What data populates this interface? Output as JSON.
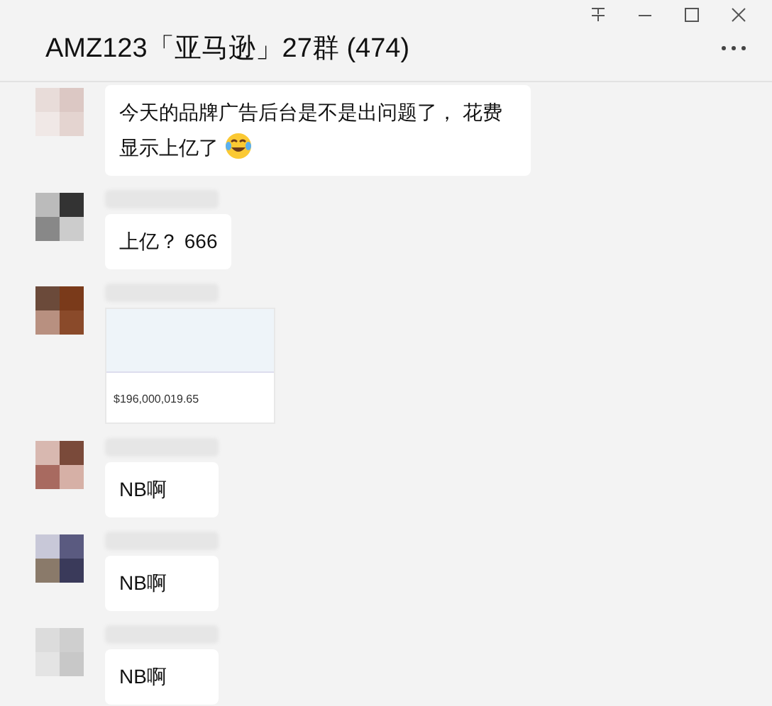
{
  "window": {
    "title": "AMZ123「亚马逊」27群 (474)"
  },
  "messages": [
    {
      "kind": "text",
      "text": "今天的品牌广告后台是不是出问题了， 花费显示上亿了",
      "emoji": true,
      "show_name": false
    },
    {
      "kind": "text",
      "text": "上亿？ 666",
      "emoji": false,
      "show_name": true
    },
    {
      "kind": "image",
      "amount": "$196,000,019.65",
      "show_name": true
    },
    {
      "kind": "text",
      "text": "NB啊",
      "emoji": false,
      "show_name": true
    },
    {
      "kind": "text",
      "text": "NB啊",
      "emoji": false,
      "show_name": true
    },
    {
      "kind": "text",
      "text": "NB啊",
      "emoji": false,
      "show_name": true
    }
  ]
}
